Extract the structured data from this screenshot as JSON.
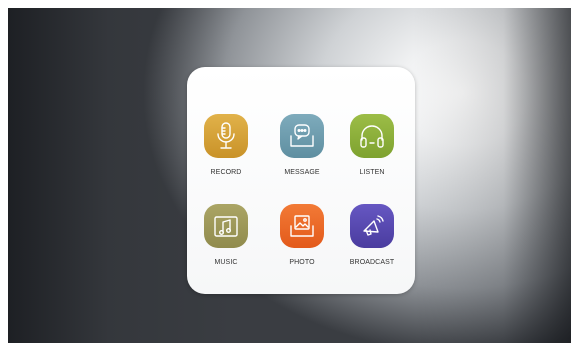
{
  "apps": [
    {
      "label": "RECORD",
      "icon": "microphone-icon",
      "color": "#d6a33a"
    },
    {
      "label": "MESSAGE",
      "icon": "chat-bubble-icon",
      "color": "#6e9eb0"
    },
    {
      "label": "LISTEN",
      "icon": "headphones-icon",
      "color": "#8fb13c"
    },
    {
      "label": "MUSIC",
      "icon": "music-note-icon",
      "color": "#9f9a5a"
    },
    {
      "label": "PHOTO",
      "icon": "image-icon",
      "color": "#ee6a28"
    },
    {
      "label": "BROADCAST",
      "icon": "megaphone-icon",
      "color": "#5a4bb3"
    }
  ]
}
